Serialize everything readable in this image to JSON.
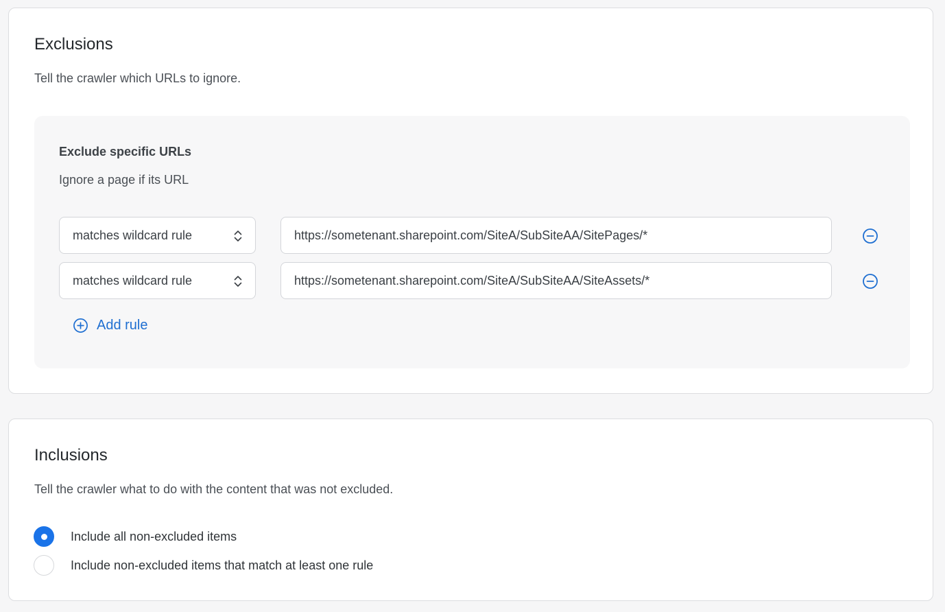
{
  "exclusions": {
    "title": "Exclusions",
    "description": "Tell the crawler which URLs to ignore.",
    "panel": {
      "title": "Exclude specific URLs",
      "description": "Ignore a page if its URL",
      "rules": [
        {
          "match_type": "matches wildcard rule",
          "url": "https://sometenant.sharepoint.com/SiteA/SubSiteAA/SitePages/*"
        },
        {
          "match_type": "matches wildcard rule",
          "url": "https://sometenant.sharepoint.com/SiteA/SubSiteAA/SiteAssets/*"
        }
      ],
      "add_rule_label": "Add rule"
    }
  },
  "inclusions": {
    "title": "Inclusions",
    "description": "Tell the crawler what to do with the content that was not excluded.",
    "options": [
      {
        "label": "Include all non-excluded items",
        "selected": true
      },
      {
        "label": "Include non-excluded items that match at least one rule",
        "selected": false
      }
    ]
  },
  "colors": {
    "accent": "#1a73e8",
    "link": "#1f6fd1",
    "panel_bg": "#f7f7f8",
    "page_bg": "#f6f6f7"
  },
  "icons": {
    "select_chevron": "chevron-up-down-icon",
    "remove": "minus-circle-icon",
    "add": "plus-circle-icon"
  }
}
